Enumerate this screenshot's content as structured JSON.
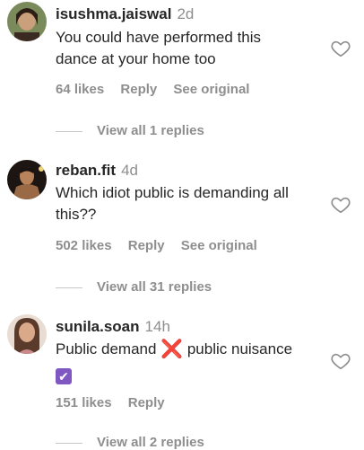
{
  "comments": [
    {
      "username": "isushma.jaiswal",
      "age": "2d",
      "text_line1": "You could have performed this",
      "text_line2": "dance at your home too",
      "likes": "64 likes",
      "reply": "Reply",
      "see_original": "See original",
      "view_replies": "View all 1 replies"
    },
    {
      "username": "reban.fit",
      "age": "4d",
      "text_line1": "Which idiot public is demanding all",
      "text_line2": "this??",
      "likes": "502 likes",
      "reply": "Reply",
      "see_original": "See original",
      "view_replies": "View all 31 replies"
    },
    {
      "username": "sunila.soan",
      "age": "14h",
      "text_part1": "Public demand",
      "text_part2": "public nuisance",
      "x_emoji": "❌",
      "check_emoji": "✔",
      "likes": "151 likes",
      "reply": "Reply",
      "view_replies": "View all 2 replies"
    }
  ],
  "icons": {
    "heart": "heart-outline-icon"
  },
  "colors": {
    "primary_text": "#262626",
    "secondary_text": "#8e8e8e",
    "x_emoji": "#e0245e",
    "check_emoji_bg": "#7e57c2"
  }
}
